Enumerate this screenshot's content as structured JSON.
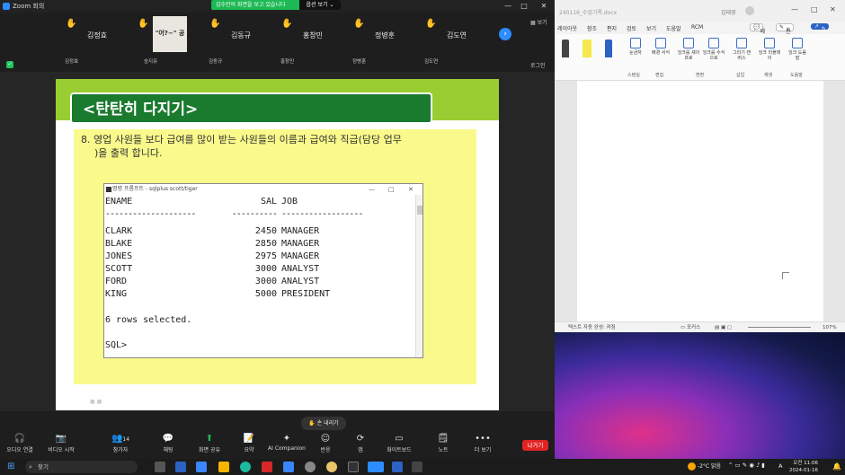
{
  "zoom": {
    "title": "Zoom 회의",
    "share_banner": "김수민의 화면을 보고 있습니다",
    "view_options": "옵션 보기",
    "view_label": "보기",
    "expand_label": "로그인",
    "participants": [
      {
        "big": "김정효",
        "small": "김정효"
      },
      {
        "big": "\"어?~\" 공작",
        "small": "송지유"
      },
      {
        "big": "김동규",
        "small": "김동규"
      },
      {
        "big": "홍창민",
        "small": "홍창민"
      },
      {
        "big": "정병훈",
        "small": "정병훈"
      },
      {
        "big": "김도연",
        "small": "김도연"
      }
    ],
    "lower_hand": "손 내리기",
    "toolbar": [
      {
        "icon": "headphones-icon",
        "glyph": "🎧",
        "label": "오디오 연결"
      },
      {
        "icon": "video-off-icon",
        "glyph": "📷",
        "label": "비디오 시작"
      },
      {
        "icon": "participants-icon",
        "glyph": "👥",
        "label": "참가자",
        "badge": "14"
      },
      {
        "icon": "chat-icon",
        "glyph": "💬",
        "label": "채팅"
      },
      {
        "icon": "share-screen-icon",
        "glyph": "⬆",
        "label": "화면 공유"
      },
      {
        "icon": "summary-icon",
        "glyph": "📝",
        "label": "요약"
      },
      {
        "icon": "ai-companion-icon",
        "glyph": "✦",
        "label": "AI Companion"
      },
      {
        "icon": "reaction-icon",
        "glyph": "☺",
        "label": "반응"
      },
      {
        "icon": "apps-icon",
        "glyph": "⟳",
        "label": "앱"
      },
      {
        "icon": "whiteboard-icon",
        "glyph": "▭",
        "label": "화이트보드"
      },
      {
        "icon": "notes-icon",
        "glyph": "🗒",
        "label": "노트"
      },
      {
        "icon": "more-icon",
        "glyph": "•••",
        "label": "더 보기"
      }
    ],
    "leave": "나가기"
  },
  "slide": {
    "title": "<탄탄히 다지기>",
    "question_line1": "8. 영업 사원들 보다 급여를 많이 받는 사원들의 이름과 급여와 직급(담당 업무",
    "question_line2": ")을 출력 합니다."
  },
  "sqlplus": {
    "title": "명령 프롬프트 - sqlplus  scott/tiger",
    "header": {
      "ename": "ENAME",
      "sal": "SAL",
      "job": "JOB"
    },
    "sep": {
      "ename": "--------------------",
      "sal": "----------",
      "job": "------------------"
    },
    "rows": [
      {
        "ename": "CLARK",
        "sal": "2450",
        "job": "MANAGER"
      },
      {
        "ename": "BLAKE",
        "sal": "2850",
        "job": "MANAGER"
      },
      {
        "ename": "JONES",
        "sal": "2975",
        "job": "MANAGER"
      },
      {
        "ename": "SCOTT",
        "sal": "3000",
        "job": "ANALYST"
      },
      {
        "ename": "FORD",
        "sal": "3000",
        "job": "ANALYST"
      },
      {
        "ename": "KING",
        "sal": "5000",
        "job": "PRESIDENT"
      }
    ],
    "footer": "6 rows selected.",
    "prompt": "SQL>"
  },
  "word": {
    "title": "240116_수업기록.docx",
    "user": "김태영",
    "tabs": [
      "레이아웃",
      "참조",
      "편지",
      "검토",
      "보기",
      "도움말",
      "RCM"
    ],
    "memo": "메모",
    "edit": "편집",
    "share": "공유",
    "ribbon": [
      {
        "label": "눈금자"
      },
      {
        "label": "배경 서식"
      },
      {
        "label": "잉크를 셰이프로"
      },
      {
        "label": "잉크를 수식으로"
      },
      {
        "label": "그리기 캔버스"
      },
      {
        "label": "잉크 리플레이"
      },
      {
        "label": "잉크 도움말"
      }
    ],
    "groups": [
      "스텐실",
      "편집",
      "변환",
      "삽입",
      "재생",
      "도움말"
    ],
    "status_left": "텍스트 자동 완성: 켜짐",
    "status_focus": "포커스",
    "zoom": "107%"
  },
  "taskbar": {
    "search": "찾기",
    "weather": "-2°C 맑음",
    "lang": "A",
    "time": "오전 11:06",
    "date": "2024-01-16"
  }
}
